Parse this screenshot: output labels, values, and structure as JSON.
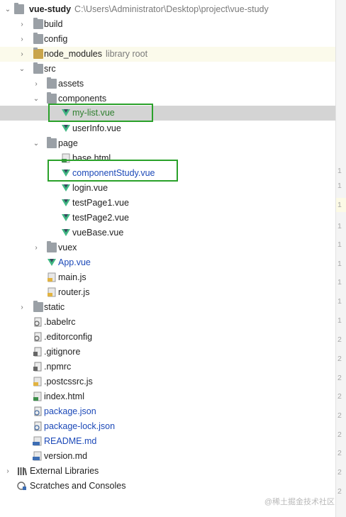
{
  "project": {
    "name": "vue-study",
    "path": "C:\\Users\\Administrator\\Desktop\\project\\vue-study"
  },
  "tree": [
    {
      "label": "build",
      "icon": "folder-icon"
    },
    {
      "label": "config",
      "icon": "folder-icon"
    },
    {
      "label": "node_modules",
      "sub": "library root",
      "icon": "folder-icon"
    },
    {
      "label": "src",
      "icon": "folder-icon"
    },
    {
      "label": "assets",
      "icon": "folder-icon"
    },
    {
      "label": "components",
      "icon": "folder-icon"
    },
    {
      "label": "my-list.vue",
      "icon": "vue-file-icon"
    },
    {
      "label": "userInfo.vue",
      "icon": "vue-file-icon"
    },
    {
      "label": "page",
      "icon": "folder-icon"
    },
    {
      "label": "base.html",
      "icon": "html-file-icon"
    },
    {
      "label": "componentStudy.vue",
      "icon": "vue-file-icon"
    },
    {
      "label": "login.vue",
      "icon": "vue-file-icon"
    },
    {
      "label": "testPage1.vue",
      "icon": "vue-file-icon"
    },
    {
      "label": "testPage2.vue",
      "icon": "vue-file-icon"
    },
    {
      "label": "vueBase.vue",
      "icon": "vue-file-icon"
    },
    {
      "label": "vuex",
      "icon": "folder-icon"
    },
    {
      "label": "App.vue",
      "icon": "vue-file-icon"
    },
    {
      "label": "main.js",
      "icon": "js-file-icon"
    },
    {
      "label": "router.js",
      "icon": "js-file-icon"
    },
    {
      "label": "static",
      "icon": "folder-icon"
    },
    {
      "label": ".babelrc",
      "icon": "config-file-icon"
    },
    {
      "label": ".editorconfig",
      "icon": "text-file-icon"
    },
    {
      "label": ".gitignore",
      "icon": "text-file-icon"
    },
    {
      "label": ".npmrc",
      "icon": "text-file-icon"
    },
    {
      "label": ".postcssrc.js",
      "icon": "js-file-icon"
    },
    {
      "label": "index.html",
      "icon": "html-file-icon"
    },
    {
      "label": "package.json",
      "icon": "json-file-icon"
    },
    {
      "label": "package-lock.json",
      "icon": "json-file-icon"
    },
    {
      "label": "README.md",
      "icon": "md-file-icon"
    },
    {
      "label": "version.md",
      "icon": "md-file-icon"
    },
    {
      "label": "External Libraries",
      "icon": "libraries-icon"
    },
    {
      "label": "Scratches and Consoles",
      "icon": "scratches-icon"
    }
  ],
  "gutter_numbers": [
    "1",
    "1",
    "1",
    "1",
    "1",
    "1",
    "1",
    "1",
    "1",
    "2",
    "2",
    "2",
    "2",
    "2",
    "2",
    "2",
    "2",
    "2",
    "2",
    "2"
  ],
  "watermark": "@稀土掘金技术社区",
  "colors": {
    "highlight_box": "#2aa12a",
    "vue_green": "#2f7f2f",
    "link_blue": "#1c49b8"
  }
}
